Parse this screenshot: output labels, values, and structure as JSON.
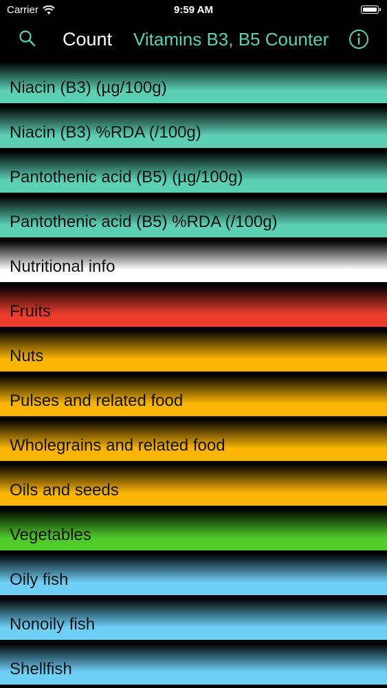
{
  "status_bar": {
    "carrier": "Carrier",
    "time": "9:59 AM",
    "icons": [
      "wifi-icon",
      "battery-icon"
    ]
  },
  "nav": {
    "search_icon": "search-icon",
    "count_label": "Count",
    "title": "Vitamins B3, B5 Counter",
    "info_icon": "info-icon",
    "title_color": "#5fd0b4"
  },
  "rows": [
    {
      "label": "Niacin (B3) (µg/100g)",
      "color": "#5ccfb4"
    },
    {
      "label": "Niacin (B3) %RDA (/100g)",
      "color": "#5ccfb4"
    },
    {
      "label": "Pantothenic acid (B5) (µg/100g)",
      "color": "#5ccfb4"
    },
    {
      "label": "Pantothenic acid (B5) %RDA (/100g)",
      "color": "#5ccfb4"
    },
    {
      "label": "Nutritional info",
      "color": "#ffffff"
    },
    {
      "label": "Fruits",
      "color": "#ee3d2e"
    },
    {
      "label": "Nuts",
      "color": "#fdb606"
    },
    {
      "label": "Pulses and related food",
      "color": "#fdb606"
    },
    {
      "label": "Wholegrains and related food",
      "color": "#fdb606"
    },
    {
      "label": "Oils and seeds",
      "color": "#fdb606"
    },
    {
      "label": "Vegetables",
      "color": "#4fcb2a"
    },
    {
      "label": "Oily fish",
      "color": "#6ecff7"
    },
    {
      "label": "Nonoily fish",
      "color": "#6ecff7"
    },
    {
      "label": "Shellfish",
      "color": "#6ecff7"
    }
  ]
}
